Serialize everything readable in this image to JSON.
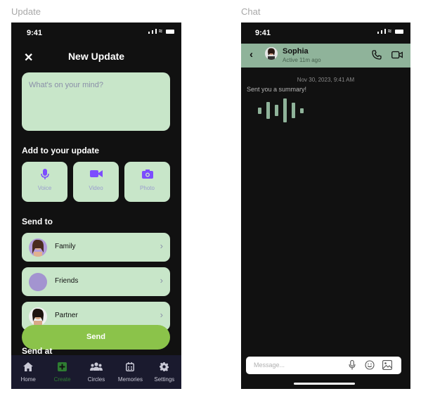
{
  "labels": {
    "update_frame": "Update",
    "chat_frame": "Chat"
  },
  "update": {
    "status_time": "9:41",
    "close_icon": "close-icon",
    "title": "New Update",
    "input_placeholder": "What's on your mind?",
    "add_heading": "Add to your update",
    "media": [
      {
        "label": "Voice",
        "icon": "microphone-icon"
      },
      {
        "label": "Video",
        "icon": "video-camera-icon"
      },
      {
        "label": "Photo",
        "icon": "camera-icon"
      }
    ],
    "send_to_heading": "Send to",
    "contacts": [
      {
        "name": "Family"
      },
      {
        "name": "Friends"
      },
      {
        "name": "Partner"
      }
    ],
    "send_label": "Send",
    "send_at_heading": "Send at",
    "tabs": [
      {
        "label": "Home",
        "icon": "home-icon"
      },
      {
        "label": "Create",
        "icon": "plus-square-icon",
        "active": true
      },
      {
        "label": "Circles",
        "icon": "group-icon"
      },
      {
        "label": "Memories",
        "icon": "calendar-icon"
      },
      {
        "label": "Settings",
        "icon": "gear-icon"
      }
    ],
    "colors": {
      "card": "#c8e6c9",
      "accent": "#8bc34a",
      "active_tab": "#2e7d32",
      "icon": "#7c4dff"
    }
  },
  "chat": {
    "status_time": "9:41",
    "contact_name": "Sophia",
    "contact_status": "Active 11m ago",
    "timestamp": "Nov 30, 2023, 9:41 AM",
    "message": "Sent you a summary!",
    "input_placeholder": "Message...",
    "colors": {
      "header": "#8fb39a"
    }
  }
}
